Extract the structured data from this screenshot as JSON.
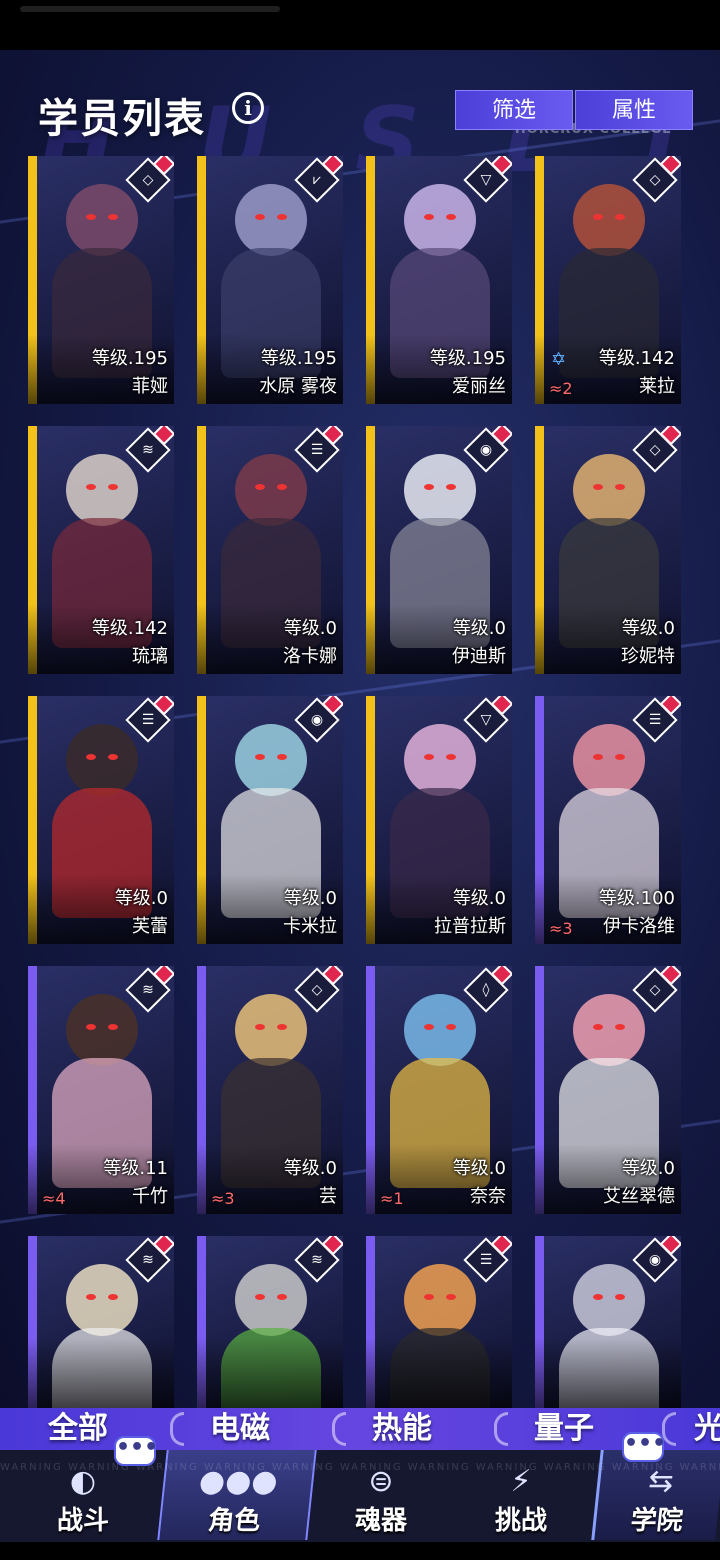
{
  "header": {
    "title": "学员列表",
    "info_icon": "i",
    "subtitle": "HORCRUX COLLEGE",
    "filter_label": "筛选",
    "attribute_label": "属性"
  },
  "characters": [
    {
      "name": "菲娅",
      "level": "等级.195",
      "rarity_color": "#f2c21a",
      "icon": "diamond-icon"
    },
    {
      "name": "水原 雾夜",
      "level": "等级.195",
      "rarity_color": "#f2c21a",
      "icon": "wing-icon"
    },
    {
      "name": "爱丽丝",
      "level": "等级.195",
      "rarity_color": "#f2c21a",
      "icon": "triangle-icon"
    },
    {
      "name": "莱拉",
      "level": "等级.142",
      "rarity_color": "#f2c21a",
      "icon": "diamond-icon",
      "star": "≈2",
      "star_icon": "✡"
    },
    {
      "name": "琉璃",
      "level": "等级.142",
      "rarity_color": "#f2c21a",
      "icon": "wifi-icon"
    },
    {
      "name": "洛卡娜",
      "level": "等级.0",
      "rarity_color": "#f2c21a",
      "icon": "stripes-icon"
    },
    {
      "name": "伊迪斯",
      "level": "等级.0",
      "rarity_color": "#f2c21a",
      "icon": "orb-icon"
    },
    {
      "name": "珍妮特",
      "level": "等级.0",
      "rarity_color": "#f2c21a",
      "icon": "diamond-icon"
    },
    {
      "name": "芙蕾",
      "level": "等级.0",
      "rarity_color": "#f2c21a",
      "icon": "stripes-icon"
    },
    {
      "name": "卡米拉",
      "level": "等级.0",
      "rarity_color": "#f2c21a",
      "icon": "orb-icon"
    },
    {
      "name": "拉普拉斯",
      "level": "等级.0",
      "rarity_color": "#f2c21a",
      "icon": "triangle-icon"
    },
    {
      "name": "伊卡洛维",
      "level": "等级.100",
      "rarity_color": "#7b5cf0",
      "icon": "stripes-icon",
      "star": "≈3"
    },
    {
      "name": "千竹",
      "level": "等级.11",
      "rarity_color": "#7b5cf0",
      "icon": "wifi-icon",
      "star": "≈4"
    },
    {
      "name": "芸",
      "level": "等级.0",
      "rarity_color": "#7b5cf0",
      "icon": "diamond-icon",
      "star": "≈3"
    },
    {
      "name": "奈奈",
      "level": "等级.0",
      "rarity_color": "#7b5cf0",
      "icon": "drop-icon",
      "star": "≈1"
    },
    {
      "name": "艾丝翠德",
      "level": "等级.0",
      "rarity_color": "#7b5cf0",
      "icon": "diamond-icon"
    },
    {
      "name": "",
      "level": "",
      "rarity_color": "#7b5cf0",
      "icon": "wifi-icon"
    },
    {
      "name": "",
      "level": "",
      "rarity_color": "#7b5cf0",
      "icon": "wifi-icon"
    },
    {
      "name": "",
      "level": "",
      "rarity_color": "#7b5cf0",
      "icon": "stripes-icon"
    },
    {
      "name": "",
      "level": "",
      "rarity_color": "#7b5cf0",
      "icon": "orb-icon"
    }
  ],
  "filter_tabs": [
    "全部",
    "电磁",
    "热能",
    "量子",
    "光"
  ],
  "bottom_nav": [
    {
      "label": "战斗",
      "icon": "globe-icon"
    },
    {
      "label": "角色",
      "icon": "team-icon"
    },
    {
      "label": "魂器",
      "icon": "helmet-icon"
    },
    {
      "label": "挑战",
      "icon": "lightning-icon"
    },
    {
      "label": "学院",
      "icon": "arrows-icon"
    }
  ],
  "chat_label": "•••",
  "warning_text": "WARNING WARNING WARNING WARNING WARNING WARNING WARNING WARNING WARNING WARNING WARNING WARNING"
}
